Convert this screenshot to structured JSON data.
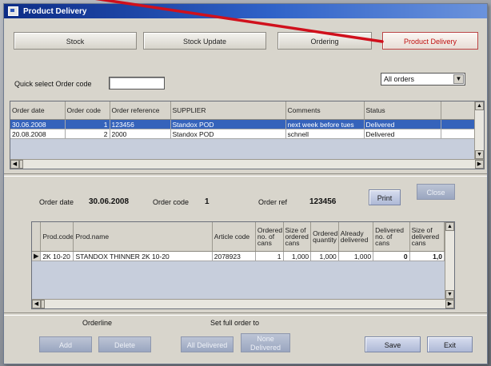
{
  "window": {
    "title": "Product Delivery"
  },
  "tabs": {
    "stock": "Stock",
    "stock_update": "Stock Update",
    "ordering": "Ordering",
    "product_delivery": "Product Delivery"
  },
  "filter": {
    "quick_select_label": "Quick select Order code",
    "quick_select_value": "",
    "status_filter": "All orders"
  },
  "orders": {
    "columns": [
      "Order date",
      "Order code",
      "Order reference",
      "SUPPLIER",
      "Comments",
      "Status"
    ],
    "rows": [
      {
        "date": "30.06.2008",
        "code": "1",
        "reference": "123456",
        "supplier": "Standox POD",
        "comments": "next week before tues",
        "status": "Delivered",
        "selected": true
      },
      {
        "date": "20.08.2008",
        "code": "2",
        "reference": "2000",
        "supplier": "Standox POD",
        "comments": "schnell",
        "status": "Delivered",
        "selected": false
      }
    ]
  },
  "detail": {
    "order_date_label": "Order date",
    "order_date": "30.06.2008",
    "order_code_label": "Order code",
    "order_code": "1",
    "order_ref_label": "Order ref",
    "order_ref": "123456",
    "print_button": "Print",
    "close_button": "Close"
  },
  "lines": {
    "columns": {
      "prod_code": "Prod.code",
      "prod_name": "Prod.name",
      "article_code": "Article code",
      "ordered_no": "Ordered no. of cans",
      "size_ordered": "Size of ordered cans",
      "ordered_qty": "Ordered quantity",
      "already_delivered": "Already delivered",
      "delivered_no": "Delivered no. of cans",
      "size_delivered": "Size of delivered cans"
    },
    "rows": [
      {
        "marker": "▶",
        "prod_code": "2K 10-20",
        "prod_name": "STANDOX THINNER 2K 10-20",
        "article_code": "2078923",
        "ordered_no": "1",
        "size_ordered": "1,000",
        "ordered_qty": "1,000",
        "already_delivered": "1,000",
        "delivered_no": "0",
        "size_delivered": "1,0"
      }
    ]
  },
  "footer": {
    "orderline_label": "Orderline",
    "set_full_order_label": "Set full order to",
    "add": "Add",
    "delete": "Delete",
    "all_delivered": "All Delivered",
    "none_delivered": "None Delivered",
    "save": "Save",
    "exit": "Exit"
  },
  "annotation": {
    "arrow_color": "#d0101c"
  },
  "icons": {
    "dropdown": "chevron-down-icon",
    "scroll_up": "arrow-up-icon",
    "scroll_down": "arrow-down-icon",
    "scroll_left": "arrow-left-icon",
    "scroll_right": "arrow-right-icon"
  }
}
